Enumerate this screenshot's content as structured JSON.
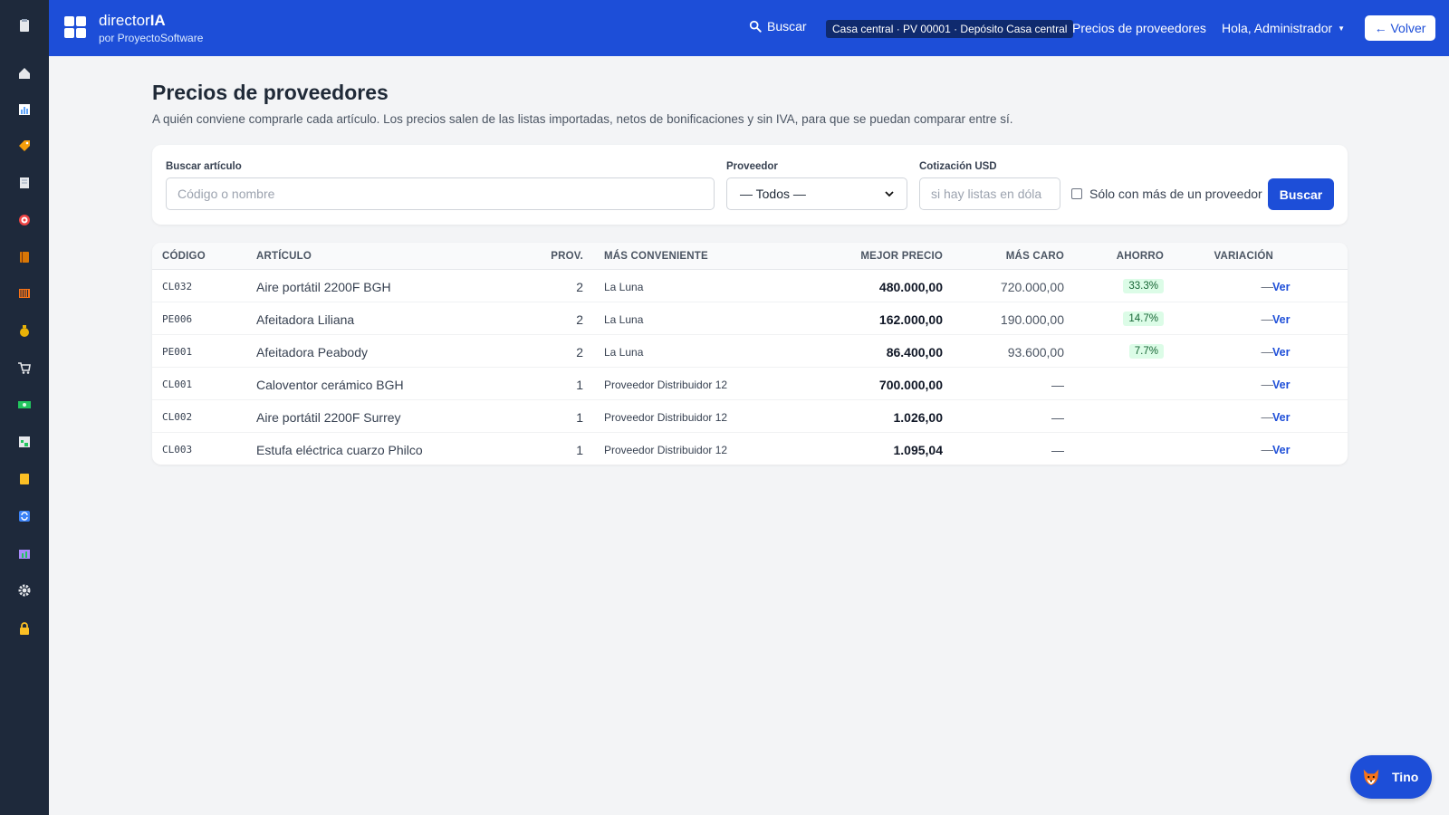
{
  "sidebar": {
    "items": [
      {
        "icon": "clipboard-icon",
        "color": "#e5e7eb"
      },
      {
        "icon": "home-icon",
        "color": "#e5e7eb"
      },
      {
        "icon": "bar-chart-icon",
        "color": "#60a5fa"
      },
      {
        "icon": "tag-icon",
        "color": "#f59e0b"
      },
      {
        "icon": "document-icon",
        "color": "#e5e7eb"
      },
      {
        "icon": "target-icon",
        "color": "#ef4444"
      },
      {
        "icon": "book-icon",
        "color": "#d97706"
      },
      {
        "icon": "barcode-icon",
        "color": "#f97316"
      },
      {
        "icon": "money-bag-icon",
        "color": "#eab308"
      },
      {
        "icon": "cart-icon",
        "color": "#e5e7eb"
      },
      {
        "icon": "banknote-icon",
        "color": "#22c55e"
      },
      {
        "icon": "spreadsheet-icon",
        "color": "#22c55e"
      },
      {
        "icon": "notepad-icon",
        "color": "#fbbf24"
      },
      {
        "icon": "sync-icon",
        "color": "#3b82f6"
      },
      {
        "icon": "folder-chart-icon",
        "color": "#a78bfa"
      },
      {
        "icon": "gear-icon",
        "color": "#e5e7eb"
      },
      {
        "icon": "lock-icon",
        "color": "#fbbf24"
      }
    ]
  },
  "header": {
    "brand": {
      "name_prefix": "director",
      "name_suffix": "IA",
      "subtitle": "por ProyectoSoftware"
    },
    "search_label": "Buscar",
    "branch_badge": "Casa central · PV 00001 · Depósito Casa central",
    "nav_link": "Precios de proveedores",
    "user_menu": "Hola, Administrador",
    "back_button": "← Volver"
  },
  "page": {
    "title": "Precios de proveedores",
    "description": "A quién conviene comprarle cada artículo. Los precios salen de las listas importadas, netos de bonificaciones y sin IVA, para que se puedan comparar entre sí."
  },
  "filters": {
    "article_label": "Buscar artículo",
    "article_placeholder": "Código o nombre",
    "article_value": "",
    "supplier_label": "Proveedor",
    "supplier_selected": "— Todos —",
    "usd_label": "Cotización USD",
    "usd_placeholder": "si hay listas en dóla",
    "multi_supplier_label": "Sólo con más de un proveedor",
    "multi_supplier_checked": false,
    "search_button": "Buscar"
  },
  "table": {
    "columns": {
      "code": "CÓDIGO",
      "article": "ARTÍCULO",
      "providers": "PROV.",
      "best_supplier": "MÁS CONVENIENTE",
      "best_price": "MEJOR PRECIO",
      "most_expensive": "MÁS CARO",
      "savings": "AHORRO",
      "variation": "VARIACIÓN"
    },
    "rows": [
      {
        "code": "CL032",
        "article": "Aire portátil 2200F BGH",
        "providers": "2",
        "best_supplier": "La Luna",
        "best_price": "480.000,00",
        "most_expensive": "720.000,00",
        "savings": "33.3%",
        "variation": "—",
        "action": "Ver"
      },
      {
        "code": "PE006",
        "article": "Afeitadora Liliana",
        "providers": "2",
        "best_supplier": "La Luna",
        "best_price": "162.000,00",
        "most_expensive": "190.000,00",
        "savings": "14.7%",
        "variation": "—",
        "action": "Ver"
      },
      {
        "code": "PE001",
        "article": "Afeitadora Peabody",
        "providers": "2",
        "best_supplier": "La Luna",
        "best_price": "86.400,00",
        "most_expensive": "93.600,00",
        "savings": "7.7%",
        "variation": "—",
        "action": "Ver"
      },
      {
        "code": "CL001",
        "article": "Caloventor cerámico BGH",
        "providers": "1",
        "best_supplier": "Proveedor Distribuidor 12",
        "best_price": "700.000,00",
        "most_expensive": "—",
        "savings": "",
        "variation": "—",
        "action": "Ver"
      },
      {
        "code": "CL002",
        "article": "Aire portátil 2200F Surrey",
        "providers": "1",
        "best_supplier": "Proveedor Distribuidor 12",
        "best_price": "1.026,00",
        "most_expensive": "—",
        "savings": "",
        "variation": "—",
        "action": "Ver"
      },
      {
        "code": "CL003",
        "article": "Estufa eléctrica cuarzo Philco",
        "providers": "1",
        "best_supplier": "Proveedor Distribuidor 12",
        "best_price": "1.095,04",
        "most_expensive": "—",
        "savings": "",
        "variation": "—",
        "action": "Ver"
      }
    ]
  },
  "assistant": {
    "label": "Tino",
    "icon": "fox-icon"
  },
  "colors": {
    "primary": "#1d4ed8",
    "sidebar": "#1e293b",
    "savings_bg": "#dcfce7",
    "savings_text": "#166534"
  }
}
